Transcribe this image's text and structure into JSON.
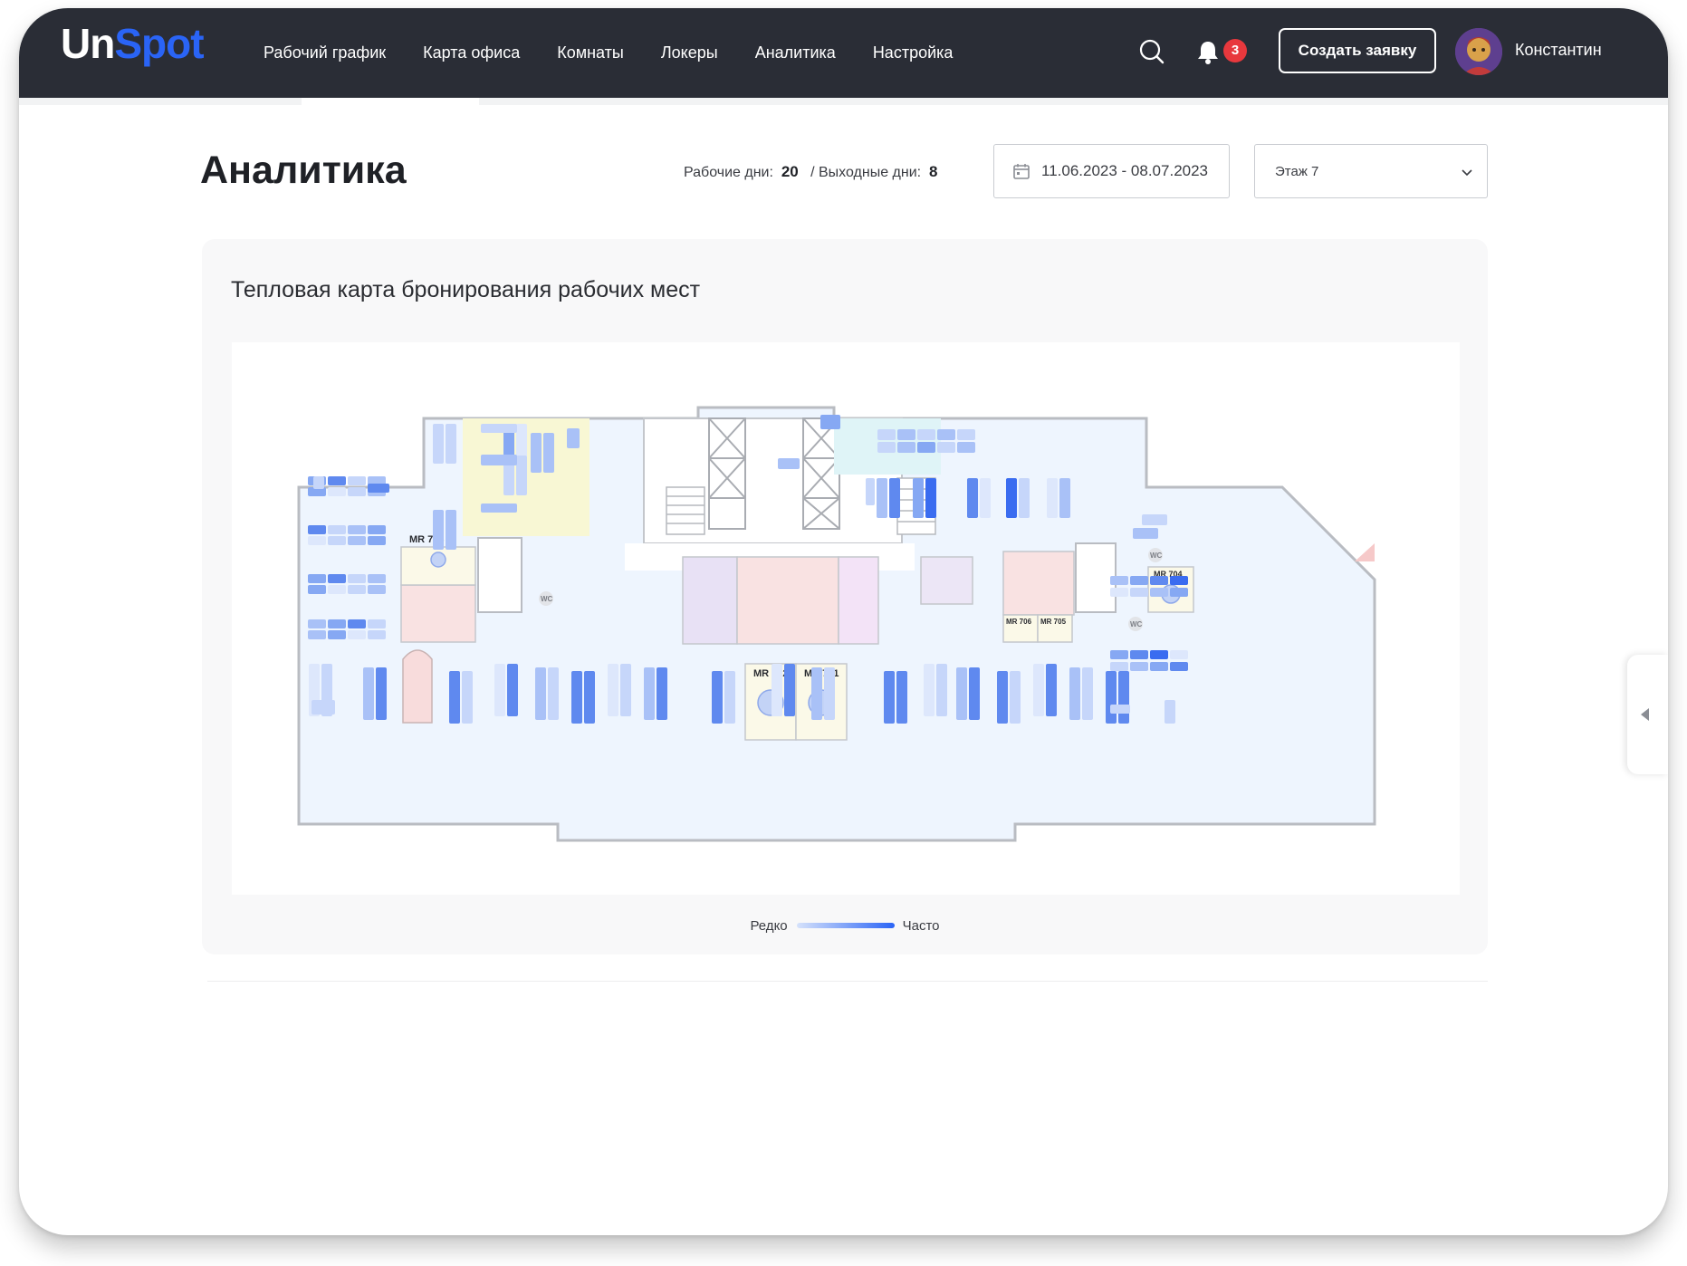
{
  "brand": {
    "logo_part1": "Un",
    "logo_part2": "Spot",
    "accent": "#2a64f6",
    "topbar_color": "#2a2d36"
  },
  "nav": {
    "items": [
      {
        "label": "Рабочий график"
      },
      {
        "label": "Карта офиса"
      },
      {
        "label": "Комнаты"
      },
      {
        "label": "Локеры"
      },
      {
        "label": "Аналитика"
      },
      {
        "label": "Настройка"
      }
    ]
  },
  "header": {
    "search_icon": "search-icon",
    "bell_icon": "bell-icon",
    "notifications_count": "3",
    "create_button": "Создать заявку",
    "user_name": "Константин"
  },
  "page": {
    "title": "Аналитика"
  },
  "stats": {
    "work_label": "Рабочие дни:",
    "work_value": "20",
    "separator": "/",
    "off_label": "Выходные дни:",
    "off_value": "8"
  },
  "filters": {
    "date_range": "11.06.2023 - 08.07.2023",
    "floor": "Этаж 7",
    "calendar_icon": "calendar-icon",
    "chevron_icon": "chevron-down-icon"
  },
  "heatmap": {
    "title": "Тепловая карта бронирования рабочих мест",
    "legend_low": "Редко",
    "legend_high": "Часто",
    "scale_colors": [
      "#d6e2fb",
      "#2a64f6"
    ],
    "rooms": [
      "MR 703",
      "MR 702",
      "MR 701",
      "MR 704",
      "MR 706",
      "MR 705"
    ],
    "wc_labels": [
      "WC",
      "WC",
      "WC"
    ]
  }
}
